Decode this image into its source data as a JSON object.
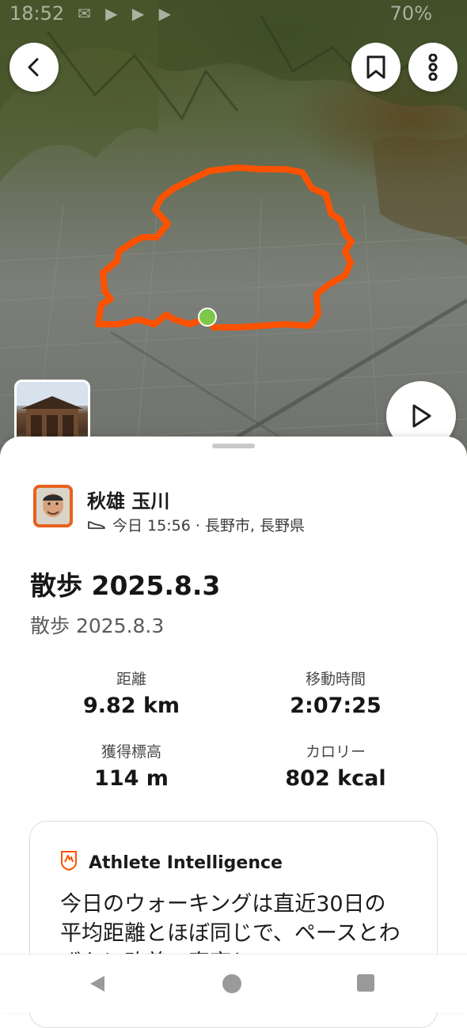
{
  "status_bar": {
    "time": "18:52",
    "battery": "70%"
  },
  "map": {
    "route_color": "#fc5200",
    "start_marker_color": "#7dc84a"
  },
  "athlete": {
    "name": "秋雄 玉川",
    "meta": "今日 15:56 · 長野市, 長野県"
  },
  "activity": {
    "title": "散歩 2025.8.3",
    "description": "散歩 2025.8.3"
  },
  "stats": [
    {
      "label": "距離",
      "value": "9.82 km"
    },
    {
      "label": "移動時間",
      "value": "2:07:25"
    },
    {
      "label": "獲得標高",
      "value": "114 m"
    },
    {
      "label": "カロリー",
      "value": "802 kcal"
    }
  ],
  "athlete_intelligence": {
    "title": "Athlete Intelligence",
    "text": "今日のウォーキングは直近30日の平均距離とほぼ同じで、ペースとわずかに改善…直率と"
  },
  "colors": {
    "accent": "#fc5200",
    "text": "#1b1b1b",
    "secondary_text": "#5b5b5b"
  }
}
